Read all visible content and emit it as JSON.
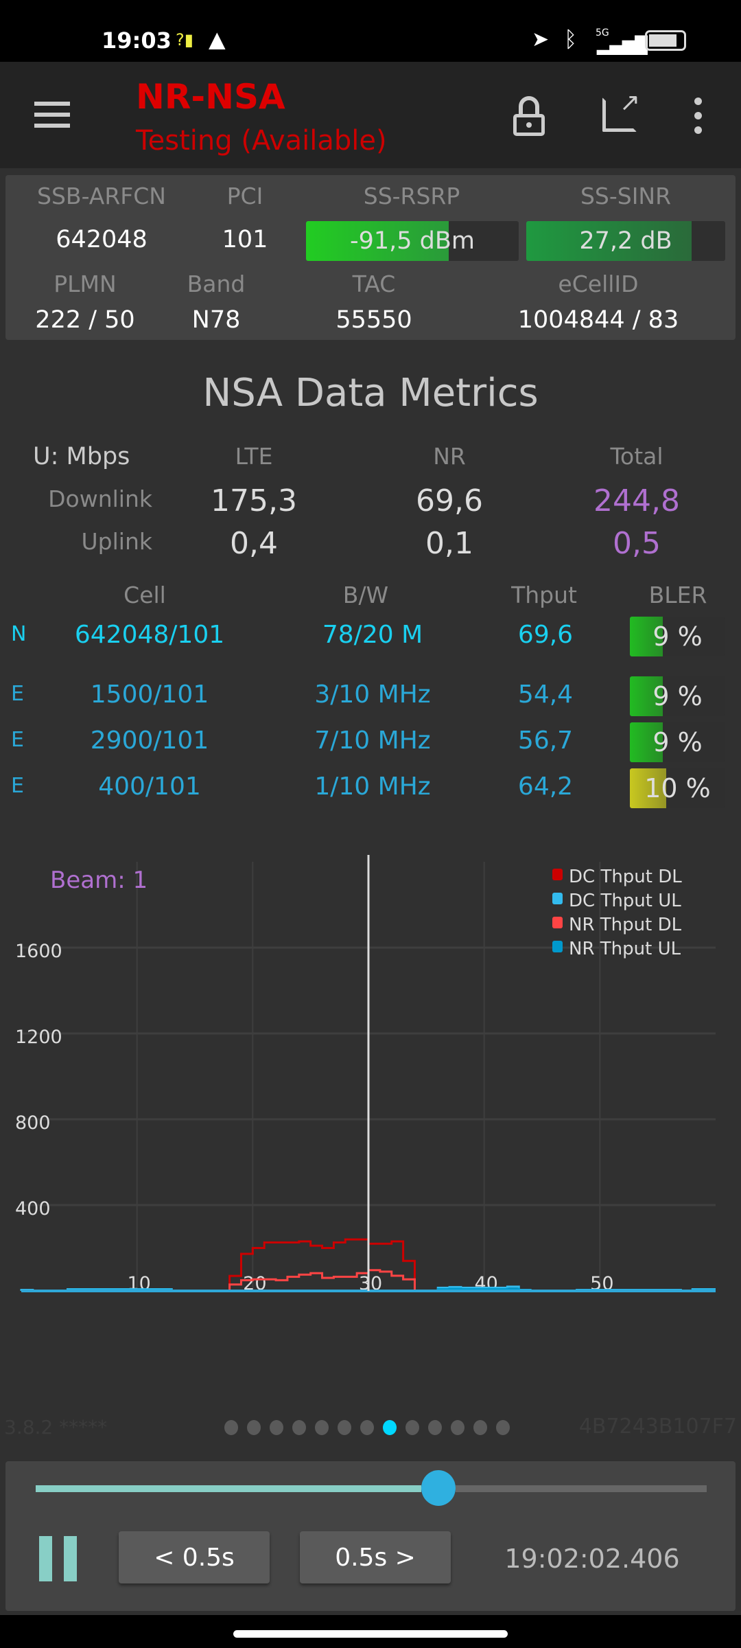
{
  "status_bar": {
    "time": "19:03",
    "network": "5G"
  },
  "toolbar": {
    "title": "NR-NSA",
    "subtitle": "Testing (Available)"
  },
  "cell_info": {
    "headers": [
      "SSB-ARFCN",
      "PCI",
      "SS-RSRP",
      "SS-SINR"
    ],
    "ssb_arfcn": "642048",
    "pci": "101",
    "rsrp": {
      "text": "-91,5 dBm",
      "fill": 0.67,
      "color": "#22cc22"
    },
    "sinr": {
      "text": "27,2 dB",
      "fill": 0.83,
      "color": "#1f9940"
    },
    "headers2": [
      "PLMN",
      "Band",
      "TAC",
      "eCellID"
    ],
    "plmn": "222 / 50",
    "band": "N78",
    "tac": "55550",
    "ecellid": "1004844 / 83"
  },
  "metrics": {
    "title": "NSA Data Metrics",
    "unit": "U: Mbps",
    "cols": [
      "LTE",
      "NR",
      "Total"
    ],
    "downlink": {
      "label": "Downlink",
      "lte": "175,3",
      "nr": "69,6",
      "total": "244,8"
    },
    "uplink": {
      "label": "Uplink",
      "lte": "0,4",
      "nr": "0,1",
      "total": "0,5"
    },
    "cell_headers": [
      "Cell",
      "B/W",
      "Thput",
      "BLER"
    ],
    "cells": [
      {
        "type": "N",
        "cell": "642048/101",
        "bw": "78/20 M",
        "thput": "69,6",
        "bler": "9 %",
        "bler_value": 9,
        "color": "#22bb22"
      },
      {
        "type": "E",
        "cell": "1500/101",
        "bw": "3/10 MHz",
        "thput": "54,4",
        "bler": "9 %",
        "bler_value": 9,
        "color": "#22bb22"
      },
      {
        "type": "E",
        "cell": "2900/101",
        "bw": "7/10 MHz",
        "thput": "56,7",
        "bler": "9 %",
        "bler_value": 9,
        "color": "#22bb22"
      },
      {
        "type": "E",
        "cell": "400/101",
        "bw": "1/10 MHz",
        "thput": "64,2",
        "bler": "10 %",
        "bler_value": 10,
        "color": "#c8c820"
      }
    ]
  },
  "chart_data": {
    "type": "line",
    "annotation": "Beam: 1",
    "xlim": [
      0,
      60
    ],
    "ylim": [
      0,
      2000
    ],
    "xticks": [
      "10",
      "20",
      "30",
      "40",
      "50"
    ],
    "yticks": [
      "400",
      "800",
      "1200",
      "1600"
    ],
    "cursor_x": 30,
    "legend_position": "top-right",
    "series": [
      {
        "name": "DC Thput DL",
        "color": "#cc0000",
        "x_start": 18,
        "values": [
          70,
          173,
          200,
          226,
          226,
          226,
          231,
          211,
          200,
          226,
          240,
          240,
          220,
          220,
          231,
          140,
          0
        ]
      },
      {
        "name": "DC Thput UL",
        "color": "#33bbee",
        "x_start": 0,
        "values": [
          5,
          0,
          0,
          0,
          8,
          8,
          8,
          8,
          8,
          8,
          8,
          8,
          8,
          0,
          0,
          0,
          0,
          0,
          0,
          0,
          0,
          0,
          0,
          0,
          0,
          0,
          0,
          0,
          0,
          0,
          0,
          0,
          0,
          0,
          0,
          0,
          15,
          18,
          15,
          15,
          15,
          15,
          20,
          5,
          0,
          0,
          0,
          0,
          5,
          5,
          5,
          5,
          5,
          5,
          5,
          5,
          5,
          0,
          8,
          8
        ]
      },
      {
        "name": "NR Thput DL",
        "color": "#ff4444",
        "x_start": 18,
        "values": [
          30,
          50,
          54,
          54,
          50,
          66,
          76,
          83,
          61,
          66,
          66,
          83,
          97,
          90,
          71,
          54,
          0
        ]
      },
      {
        "name": "NR Thput UL",
        "color": "#0099cc",
        "x_start": 0,
        "values": [
          0,
          0,
          0,
          0,
          3,
          3,
          3,
          3,
          3,
          3,
          3,
          3,
          3,
          0,
          0,
          0,
          0,
          0,
          0,
          0,
          0,
          0,
          0,
          0,
          0,
          0,
          0,
          0,
          0,
          0,
          0,
          0,
          0,
          0,
          0,
          0,
          8,
          10,
          8,
          8,
          8,
          8,
          10,
          3,
          0,
          0,
          0,
          0,
          2,
          2,
          2,
          2,
          2,
          2,
          2,
          2,
          2,
          0,
          3,
          3
        ]
      }
    ]
  },
  "footer": {
    "version": "3.8.2 *****",
    "device_id": "4B7243B107F7",
    "pages": 13,
    "active_page": 7
  },
  "player": {
    "progress": 0.6,
    "back_label": "< 0.5s",
    "forward_label": "0.5s >",
    "time": "19:02:02.406"
  }
}
